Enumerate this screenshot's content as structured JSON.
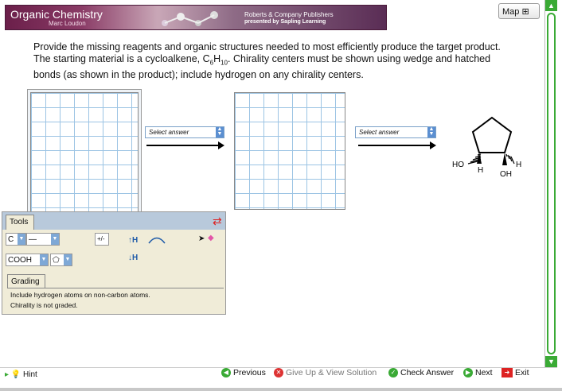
{
  "banner": {
    "title": "Organic Chemistry",
    "author": "Marc Loudon",
    "publisher": "Roberts & Company Publishers",
    "presented": "presented by Sapling Learning"
  },
  "map": {
    "label": "Map"
  },
  "question": {
    "line1": "Provide the missing reagents and organic structures needed to most efficiently produce the target product.",
    "line2a": "The starting material is a cycloalkene, C",
    "sub1": "6",
    "line2b": "H",
    "sub2": "10",
    "line2c": ". Chirality centers must be shown using wedge and hatched",
    "line3": "bonds (as shown in the product); include hydrogen on any chirality centers."
  },
  "selects": {
    "select1": "Select answer",
    "select2": "Select answer"
  },
  "product": {
    "ho": "HO",
    "h1": "H",
    "h2": "H",
    "oh": "OH"
  },
  "tools": {
    "tab": "Tools",
    "element": "C",
    "group": "COOH",
    "charge": "+/-",
    "h_up": "↑H",
    "h_down": "↓H"
  },
  "grading": {
    "tab": "Grading",
    "line1": "Include hydrogen atoms on non-carbon atoms.",
    "line2": "Chirality is not graded."
  },
  "bottom": {
    "hint": "Hint",
    "previous": "Previous",
    "give_up": "Give Up & View Solution",
    "check": "Check Answer",
    "next": "Next",
    "exit": "Exit"
  }
}
